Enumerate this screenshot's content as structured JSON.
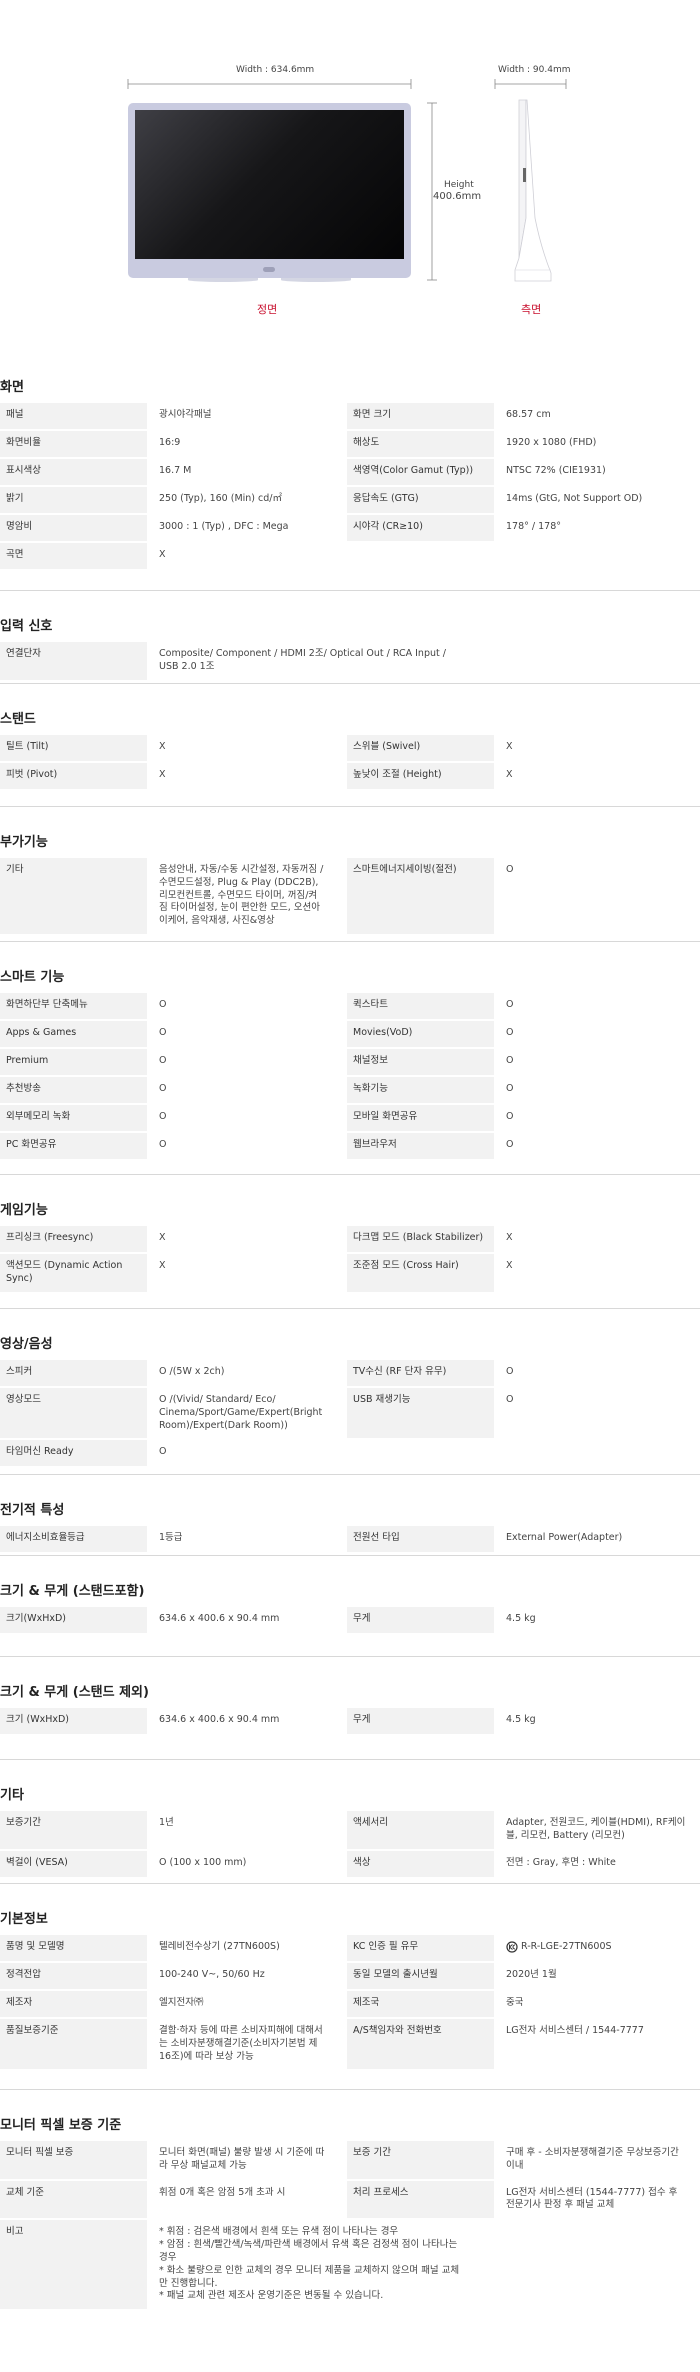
{
  "figure": {
    "front_width": "Width : 634.6mm",
    "side_width": "Width : 90.4mm",
    "height_line1": "Height",
    "height_line2": "400.6mm",
    "front_label": "정면",
    "side_label": "측면"
  },
  "colors": {
    "accent": "#c8102e",
    "label_bg": "#f2f2f2"
  },
  "sections": [
    {
      "title": "화면",
      "rows": [
        [
          {
            "label": "패널",
            "value": "광시야각패널"
          },
          {
            "label": "화면 크기",
            "value": "68.57 cm"
          }
        ],
        [
          {
            "label": "화면비율",
            "value": "16:9"
          },
          {
            "label": "해상도",
            "value": "1920 x 1080 (FHD)"
          }
        ],
        [
          {
            "label": "표시색상",
            "value": "16.7 M"
          },
          {
            "label": "색영역(Color Gamut (Typ))",
            "value": "NTSC 72% (CIE1931)"
          }
        ],
        [
          {
            "label": "밝기",
            "value": "250 (Typ), 160 (Min) cd/㎡"
          },
          {
            "label": "응답속도 (GTG)",
            "value": "14ms (GtG, Not Support OD)"
          }
        ],
        [
          {
            "label": "명암비",
            "value": "3000 : 1 (Typ) , DFC : Mega"
          },
          {
            "label": "시야각 (CR≥10)",
            "value": "178° / 178°"
          }
        ],
        [
          {
            "label": "곡면",
            "value": "X"
          }
        ]
      ]
    },
    {
      "title": "입력 신호",
      "rows": [
        [
          {
            "label": "연결단자",
            "value": "Composite/ Component / HDMI 2조/ Optical Out / RCA Input / USB 2.0 1조"
          }
        ]
      ]
    },
    {
      "title": "스탠드",
      "rows": [
        [
          {
            "label": "틸트 (Tilt)",
            "value": "X"
          },
          {
            "label": "스위블 (Swivel)",
            "value": "X"
          }
        ],
        [
          {
            "label": "피벗 (Pivot)",
            "value": "X"
          },
          {
            "label": "높낮이 조절 (Height)",
            "value": "X"
          }
        ]
      ]
    },
    {
      "title": "부가기능",
      "rows": [
        [
          {
            "label": "기타",
            "value": "음성안내, 자동/수동 시간설정, 자동꺼짐 / 수면모드설정, Plug & Play (DDC2B), 리모컨컨트롤, 수면모드 타이머, 꺼짐/켜짐 타이머설정, 눈이 편안한 모드, 오션아이케어, 음악재생, 사진&영상"
          },
          {
            "label": "스마트에너지세이빙(절전)",
            "value": "O"
          }
        ]
      ]
    },
    {
      "title": "스마트 기능",
      "rows": [
        [
          {
            "label": "화면하단부 단축메뉴",
            "value": "O"
          },
          {
            "label": "퀵스타트",
            "value": "O"
          }
        ],
        [
          {
            "label": "Apps & Games",
            "value": "O"
          },
          {
            "label": "Movies(VoD)",
            "value": "O"
          }
        ],
        [
          {
            "label": "Premium",
            "value": "O"
          },
          {
            "label": "채널정보",
            "value": "O"
          }
        ],
        [
          {
            "label": "추천방송",
            "value": "O"
          },
          {
            "label": "녹화기능",
            "value": "O"
          }
        ],
        [
          {
            "label": "외부메모리 녹화",
            "value": "O"
          },
          {
            "label": "모바일 화면공유",
            "value": "O"
          }
        ],
        [
          {
            "label": "PC 화면공유",
            "value": "O"
          },
          {
            "label": "웹브라우저",
            "value": "O"
          }
        ]
      ]
    },
    {
      "title": "게임기능",
      "rows": [
        [
          {
            "label": "프리싱크 (Freesync)",
            "value": "X"
          },
          {
            "label": "다크맵 모드 (Black Stabilizer)",
            "value": "X"
          }
        ],
        [
          {
            "label": "액션모드 (Dynamic Action Sync)",
            "value": "X"
          },
          {
            "label": "조준점 모드 (Cross Hair)",
            "value": "X"
          }
        ]
      ]
    },
    {
      "title": "영상/음성",
      "rows": [
        [
          {
            "label": "스피커",
            "value": "O /(5W x 2ch)"
          },
          {
            "label": "TV수신 (RF 단자 유무)",
            "value": "O"
          }
        ],
        [
          {
            "label": "영상모드",
            "value": "O /(Vivid/ Standard/ Eco/ Cinema/Sport/Game/Expert(Bright Room)/Expert(Dark Room))"
          },
          {
            "label": "USB 재생기능",
            "value": "O"
          }
        ],
        [
          {
            "label": "타임머신 Ready",
            "value": "O"
          }
        ]
      ]
    },
    {
      "title": "전기적 특성",
      "rows": [
        [
          {
            "label": "에너지소비효율등급",
            "value": "1등급"
          },
          {
            "label": "전원선 타입",
            "value": "External Power(Adapter)"
          }
        ]
      ]
    },
    {
      "title": "크기 & 무게 (스탠드포함)",
      "rows": [
        [
          {
            "label": "크기(WxHxD)",
            "value": "634.6 x 400.6 x 90.4 mm"
          },
          {
            "label": "무게",
            "value": "4.5 kg"
          }
        ]
      ]
    },
    {
      "title": "크기 & 무게 (스탠드 제외)",
      "rows": [
        [
          {
            "label": "크기 (WxHxD)",
            "value": "634.6 x 400.6 x 90.4 mm"
          },
          {
            "label": "무게",
            "value": "4.5 kg"
          }
        ]
      ]
    },
    {
      "title": "기타",
      "rows": [
        [
          {
            "label": "보증기간",
            "value": "1년"
          },
          {
            "label": "액세서리",
            "value": "Adapter, 전원코드, 케이블(HDMI), RF케이블, 리모컨, Battery (리모컨)"
          }
        ],
        [
          {
            "label": "벽걸이 (VESA)",
            "value": "O (100 x 100 mm)"
          },
          {
            "label": "색상",
            "value": "전면 : Gray, 후면 : White"
          }
        ]
      ]
    },
    {
      "title": "기본정보",
      "rows": [
        [
          {
            "label": "품명 및 모델명",
            "value": "텔레비전수상기 (27TN600S)"
          },
          {
            "label": "KC 인증 필 유무",
            "value": "R-R-LGE-27TN600S",
            "kc": true
          }
        ],
        [
          {
            "label": "정격전압",
            "value": "100-240 V~, 50/60 Hz"
          },
          {
            "label": "동일 모델의 출시년월",
            "value": "2020년 1월"
          }
        ],
        [
          {
            "label": "제조자",
            "value": "엘지전자㈜"
          },
          {
            "label": "제조국",
            "value": "중국"
          }
        ],
        [
          {
            "label": "품질보증기준",
            "value": "결함·하자 등에 따른 소비자피해에 대해서는 소비자분쟁해결기준(소비자기본법 제16조)에 따라 보상 가능"
          },
          {
            "label": "A/S책임자와 전화번호",
            "value": "LG전자 서비스센터 / 1544-7777"
          }
        ]
      ]
    },
    {
      "title": "모니터 픽셀 보증 기준",
      "rows": [
        [
          {
            "label": "모니터 픽셀 보증",
            "value": "모니터 화면(패널) 불량 발생 시 기준에 따라 무상 패널교체 가능"
          },
          {
            "label": "보증 기간",
            "value": "구매 후 - 소비자분쟁해결기준 무상보증기간 이내"
          }
        ],
        [
          {
            "label": "교체 기준",
            "value": "휘점 0개 혹은 암점 5개 초과 시"
          },
          {
            "label": "처리 프로세스",
            "value": "LG전자 서비스센터 (1544-7777) 접수 후 전문기사 판정 후 패널 교체"
          }
        ],
        [
          {
            "label": "비고",
            "value": "* 휘점 : 검은색 배경에서 흰색 또는 유색 점이 나타나는 경우\n* 암점 : 흰색/빨간색/녹색/파란색 배경에서 유색 혹은 검정색 점이 나타나는 경우\n* 화소 불량으로 인한 교체의 경우 모니터 제품을 교체하지 않으며 패널 교체만 진행합니다.\n* 패널 교체 관련 제조사 운영기준은 변동될 수 있습니다."
          }
        ]
      ]
    }
  ]
}
